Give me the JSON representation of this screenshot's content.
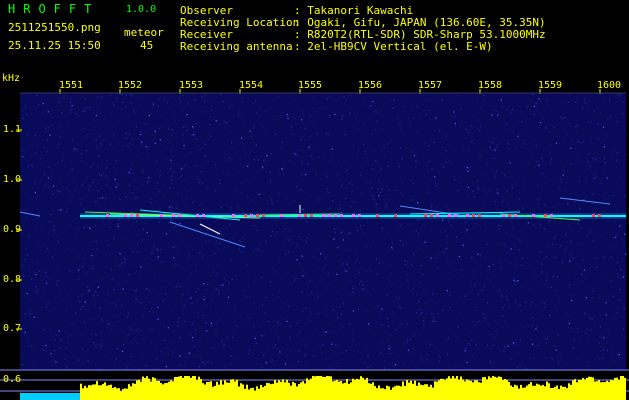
{
  "header": {
    "app_title": "HROFFT",
    "app_version": "1.0.0",
    "filename": "2511251550.png",
    "datetime": "25.11.25 15:50",
    "event_label": "meteor",
    "event_count": "45"
  },
  "station": {
    "labels": [
      "Observer",
      "Receiving Location",
      "Receiver",
      "Receiving antenna"
    ],
    "values": [
      ": Takanori Kawachi",
      ": Ogaki, Gifu, JAPAN (136.60E, 35.35N)",
      ": R820T2(RTL-SDR) SDR-Sharp 53.1000MHz",
      ": 2el-HB9CV Vertical (el. E-W)"
    ]
  },
  "axes": {
    "y_unit": "kHz",
    "x_ticks": [
      "1551",
      "1552",
      "1553",
      "1554",
      "1555",
      "1556",
      "1557",
      "1558",
      "1559",
      "1600"
    ],
    "y_ticks": [
      "1.1",
      "1.0",
      "0.9",
      "0.8",
      "0.7",
      "0.6"
    ]
  },
  "colors": {
    "text": "#ffff00",
    "title": "#00ff00",
    "background": "#000000",
    "noise": "#0a0a5a",
    "signal": "#00ffff",
    "level_bars": "#ffff00",
    "baseline": "#00ccff"
  }
}
